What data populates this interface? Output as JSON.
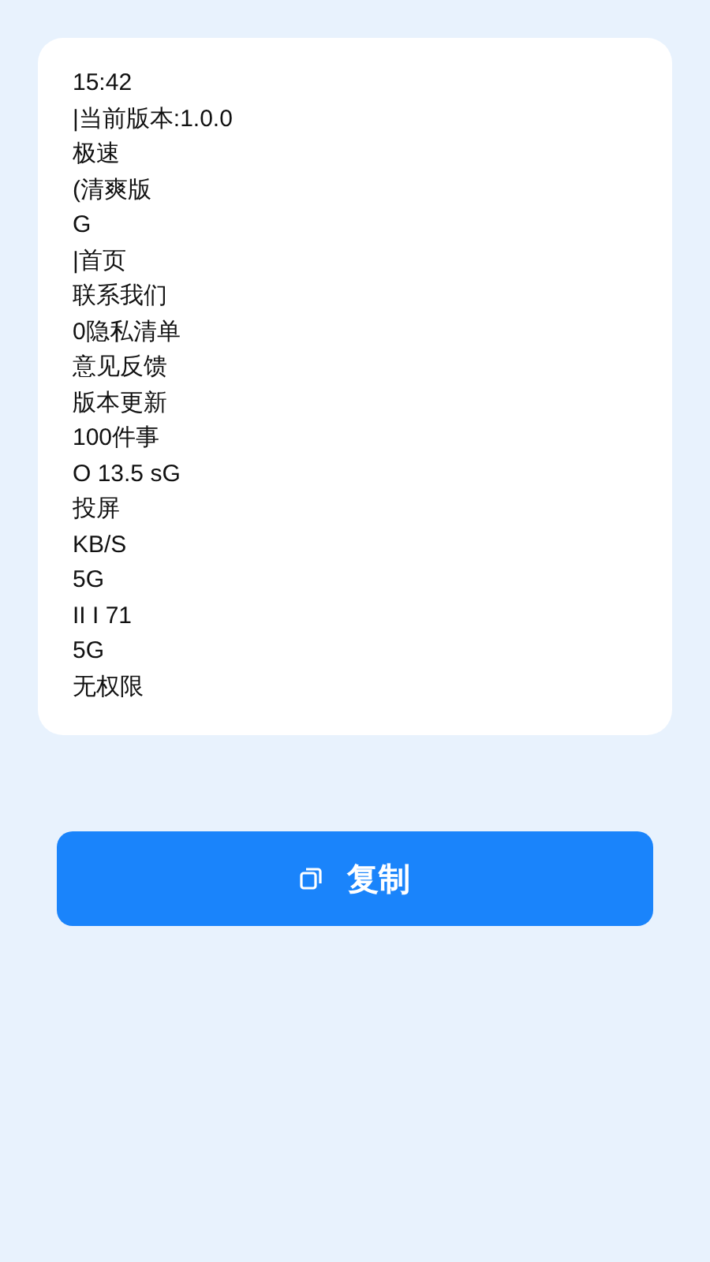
{
  "result_lines": [
    "15:42",
    "|当前版本:1.0.0",
    "极速",
    "(清爽版",
    "G",
    "|首页",
    "联系我们",
    "0隐私清单",
    "意见反馈",
    "版本更新",
    "100件事",
    "O 13.5 sG",
    "投屏",
    "KB/S",
    "5G",
    "II I 71",
    "5G",
    "无权限"
  ],
  "copy_button": {
    "label": "复制"
  }
}
